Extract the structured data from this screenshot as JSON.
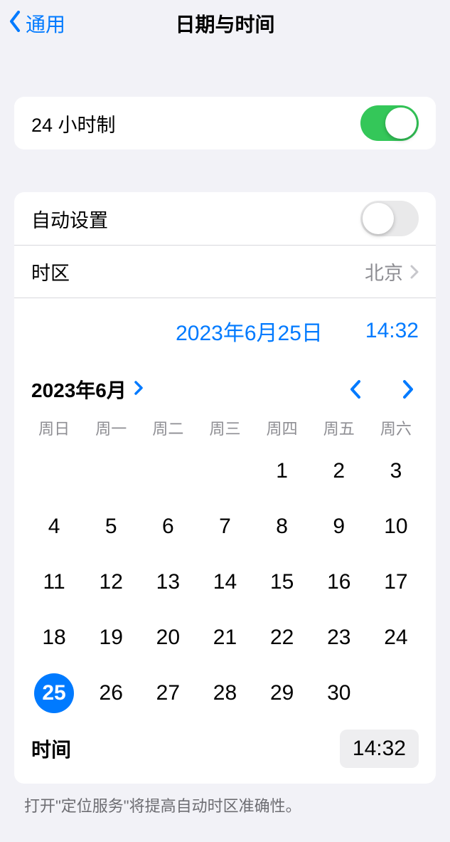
{
  "nav": {
    "back": "通用",
    "title": "日期与时间"
  },
  "group1": {
    "clock24": {
      "label": "24 小时制",
      "on": true
    }
  },
  "group2": {
    "auto": {
      "label": "自动设置",
      "on": false
    },
    "tz": {
      "label": "时区",
      "value": "北京"
    },
    "dt": {
      "date": "2023年6月25日",
      "time": "14:32"
    },
    "cal": {
      "month_title": "2023年6月",
      "weekdays": [
        "周日",
        "周一",
        "周二",
        "周三",
        "周四",
        "周五",
        "周六"
      ],
      "leading_blanks": 4,
      "days": [
        1,
        2,
        3,
        4,
        5,
        6,
        7,
        8,
        9,
        10,
        11,
        12,
        13,
        14,
        15,
        16,
        17,
        18,
        19,
        20,
        21,
        22,
        23,
        24,
        25,
        26,
        27,
        28,
        29,
        30
      ],
      "selected": 25
    },
    "time": {
      "label": "时间",
      "value": "14:32"
    }
  },
  "footer": "打开\"定位服务\"将提高自动时区准确性。"
}
